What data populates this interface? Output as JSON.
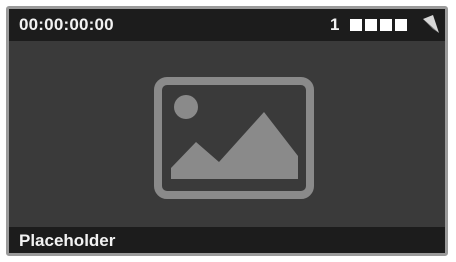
{
  "viewer": {
    "timecode": "00:00:00:00",
    "channel": "1",
    "level_bars": 4,
    "caption": "Placeholder"
  },
  "icons": {
    "corner": "corner-fold-icon",
    "preview": "image-placeholder-icon"
  },
  "colors": {
    "background": "#3a3a3a",
    "bar": "#1c1c1c",
    "text": "#f2f2f2",
    "icon": "#8a8a8a",
    "border": "#9a9a9a"
  }
}
